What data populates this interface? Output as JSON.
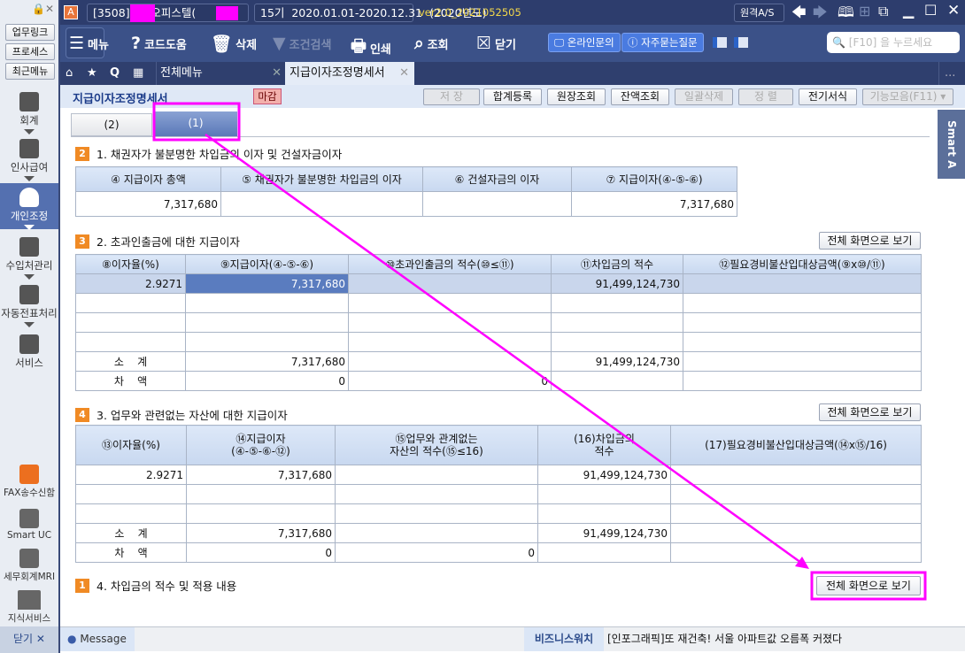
{
  "sidebar": {
    "top_buttons": [
      "업무링크",
      "프로세스",
      "최근메뉴"
    ],
    "items": [
      {
        "label": "회계"
      },
      {
        "label": "인사급여"
      },
      {
        "label": "개인조정",
        "selected": true
      },
      {
        "label": "수입처관리"
      },
      {
        "label": "자동전표처리"
      },
      {
        "label": "서비스"
      }
    ],
    "bottom_items": [
      "FAX송수신함",
      "Smart UC",
      "세무회계MRI",
      "지식서비스"
    ],
    "close_label": "닫기"
  },
  "titlebar": {
    "app_icon": "A",
    "company": "[3508]      오피스텔(        )",
    "period": "15기  2020.01.01-2020.12.31  (2020년도)",
    "version": "ver2.0_2021052505",
    "remote_as": "원격A/S"
  },
  "toolbar": {
    "menu": "메뉴",
    "code_help": "코드도움",
    "delete": "삭제",
    "filter": "조건검색",
    "print": "인쇄",
    "search": "조회",
    "close": "닫기",
    "online_inquiry": "온라인문의",
    "faq": "자주묻는질문",
    "search_placeholder": "[F10] 을 누르세요"
  },
  "tabs": {
    "items": [
      {
        "label": "전체메뉴"
      },
      {
        "label": "지급이자조정명세서",
        "active": true
      }
    ],
    "more": "..."
  },
  "form": {
    "title": "지급이자조정명세서",
    "badge": "마감",
    "buttons": [
      {
        "label": "저   장",
        "disabled": true
      },
      {
        "label": "합계등록"
      },
      {
        "label": "원장조회"
      },
      {
        "label": "잔액조회"
      },
      {
        "label": "일괄삭제",
        "disabled": true
      },
      {
        "label": "정   렬",
        "disabled": true
      },
      {
        "label": "전기서식"
      },
      {
        "label": "기능모음(F11) ▾",
        "disabled": true
      }
    ],
    "subtabs": [
      "(2)",
      "(1)"
    ],
    "smart_tab": "Smart A",
    "full_screen": "전체 화면으로 보기"
  },
  "section1": {
    "num": "2",
    "title": "1. 채권자가 불분명한 차입금의 이자 및 건설자금이자",
    "headers": [
      "④ 지급이자 총액",
      "⑤ 채권자가 불분명한 차입금의 이자",
      "⑥ 건설자금의 이자",
      "⑦ 지급이자(④-⑤-⑥)"
    ],
    "row": [
      "7,317,680",
      "",
      "",
      "7,317,680"
    ]
  },
  "section2": {
    "num": "3",
    "title": "2. 초과인출금에 대한 지급이자",
    "headers": [
      "⑧이자율(%)",
      "⑨지급이자(④-⑤-⑥)",
      "⑩초과인출금의 적수(⑩≤⑪)",
      "⑪차입금의 적수",
      "⑫필요경비불산입대상금액(⑨x⑩/⑪)"
    ],
    "rows": [
      [
        "2.9271",
        "7,317,680",
        "",
        "91,499,124,730",
        ""
      ],
      [
        "",
        "",
        "",
        "",
        ""
      ],
      [
        "",
        "",
        "",
        "",
        ""
      ],
      [
        "",
        "",
        "",
        "",
        ""
      ]
    ],
    "subtotal": [
      "소    계",
      "7,317,680",
      "",
      "91,499,124,730",
      ""
    ],
    "diff": [
      "차    액",
      "0",
      "0",
      "",
      ""
    ]
  },
  "section3": {
    "num": "4",
    "title": "3. 업무와 관련없는 자산에 대한 지급이자",
    "headers": [
      "⑬이자율(%)",
      "⑭지급이자\n(④-⑤-⑥-⑫)",
      "⑮업무와 관계없는\n자산의 적수(⑮≤16)",
      "(16)차입금의\n적수",
      "(17)필요경비불산입대상금액(⑭x⑮/16)"
    ],
    "rows": [
      [
        "2.9271",
        "7,317,680",
        "",
        "91,499,124,730",
        ""
      ],
      [
        "",
        "",
        "",
        "",
        ""
      ],
      [
        "",
        "",
        "",
        "",
        ""
      ]
    ],
    "subtotal": [
      "소    계",
      "7,317,680",
      "",
      "91,499,124,730",
      ""
    ],
    "diff": [
      "차    액",
      "0",
      "0",
      "",
      ""
    ]
  },
  "section4": {
    "num": "1",
    "title": "4. 차입금의 적수 및 적용 내용"
  },
  "statusbar": {
    "message": "Message",
    "biz_label": "비즈니스워치",
    "news": "[인포그래픽]또 재건축! 서울 아파트값 오름폭 커졌다"
  },
  "colors": {
    "accent": "#f08a24",
    "annotation": "#ff00ff",
    "selected": "#5470b0"
  }
}
